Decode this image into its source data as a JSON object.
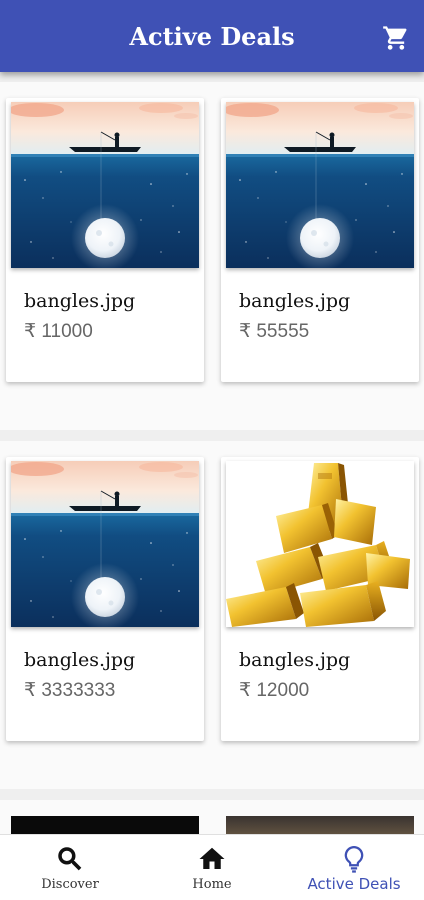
{
  "header": {
    "title": "Active Deals",
    "cart_icon": "shopping-cart-icon"
  },
  "deals": [
    {
      "name": "bangles.jpg",
      "price": "₹ 11000",
      "image": "fishing-boat-moon"
    },
    {
      "name": "bangles.jpg",
      "price": "₹ 55555",
      "image": "fishing-boat-moon"
    },
    {
      "name": "bangles.jpg",
      "price": "₹ 3333333",
      "image": "fishing-boat-moon"
    },
    {
      "name": "bangles.jpg",
      "price": "₹ 12000",
      "image": "gold-bars"
    }
  ],
  "bottom_nav": [
    {
      "label": "Discover",
      "icon": "search-icon",
      "active": false
    },
    {
      "label": "Home",
      "icon": "home-icon",
      "active": false
    },
    {
      "label": "Active Deals",
      "icon": "lightbulb-icon",
      "active": true
    }
  ],
  "colors": {
    "primary": "#3f51b5",
    "background": "#efefef",
    "card": "#ffffff",
    "price_text": "#666666"
  }
}
